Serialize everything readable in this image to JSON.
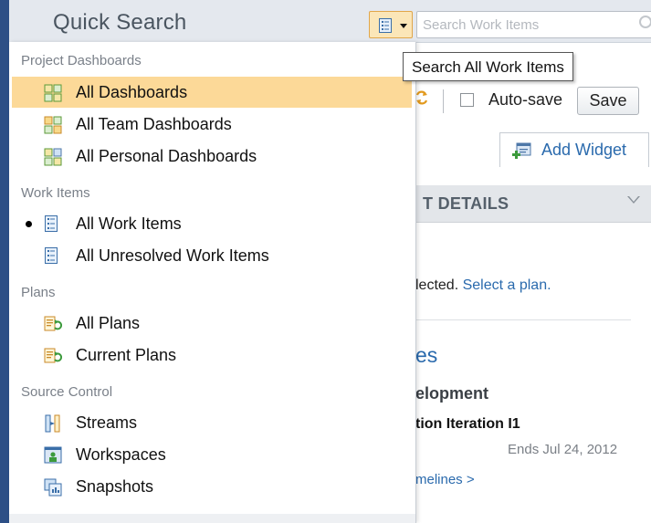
{
  "header": {
    "title": "Quick Search",
    "search_toggle_icon": "work-item-list-icon",
    "search_placeholder": "Search Work Items"
  },
  "tooltip": "Search All Work Items",
  "background_page": {
    "toolbar": {
      "refresh_icon": "sync-icon",
      "autosave_label": "Auto-save",
      "autosave_checked": false,
      "save_label": "Save"
    },
    "add_widget_label": "Add Widget",
    "widget_title_fragment": "T DETAILS",
    "plan_text_fragment": "lected.",
    "select_plan_link": "Select a plan.",
    "section_fragment": "es",
    "development_fragment": "elopment",
    "iteration_fragment": "tion Iteration I1",
    "ends_text": "Ends Jul 24, 2012",
    "timelines_link_fragment": "melines >"
  },
  "menu": {
    "sections": [
      {
        "title": "Project Dashboards",
        "items": [
          {
            "label": "All Dashboards",
            "icon": "dashboard-icon",
            "selected": true
          },
          {
            "label": "All Team Dashboards",
            "icon": "team-dashboard-icon",
            "selected": false
          },
          {
            "label": "All Personal Dashboards",
            "icon": "personal-dashboard-icon",
            "selected": false
          }
        ]
      },
      {
        "title": "Work Items",
        "items": [
          {
            "label": "All Work Items",
            "icon": "work-item-list-icon",
            "current": true
          },
          {
            "label": "All Unresolved Work Items",
            "icon": "work-item-list-icon",
            "current": false
          }
        ]
      },
      {
        "title": "Plans",
        "items": [
          {
            "label": "All Plans",
            "icon": "plan-icon"
          },
          {
            "label": "Current Plans",
            "icon": "plan-icon"
          }
        ]
      },
      {
        "title": "Source Control",
        "items": [
          {
            "label": "Streams",
            "icon": "stream-icon"
          },
          {
            "label": "Workspaces",
            "icon": "workspace-icon"
          },
          {
            "label": "Snapshots",
            "icon": "snapshot-icon"
          }
        ]
      }
    ]
  },
  "colors": {
    "selected_bg": "#fcd998",
    "link": "#2a6aad",
    "brand_strip": "#2d4f86"
  }
}
